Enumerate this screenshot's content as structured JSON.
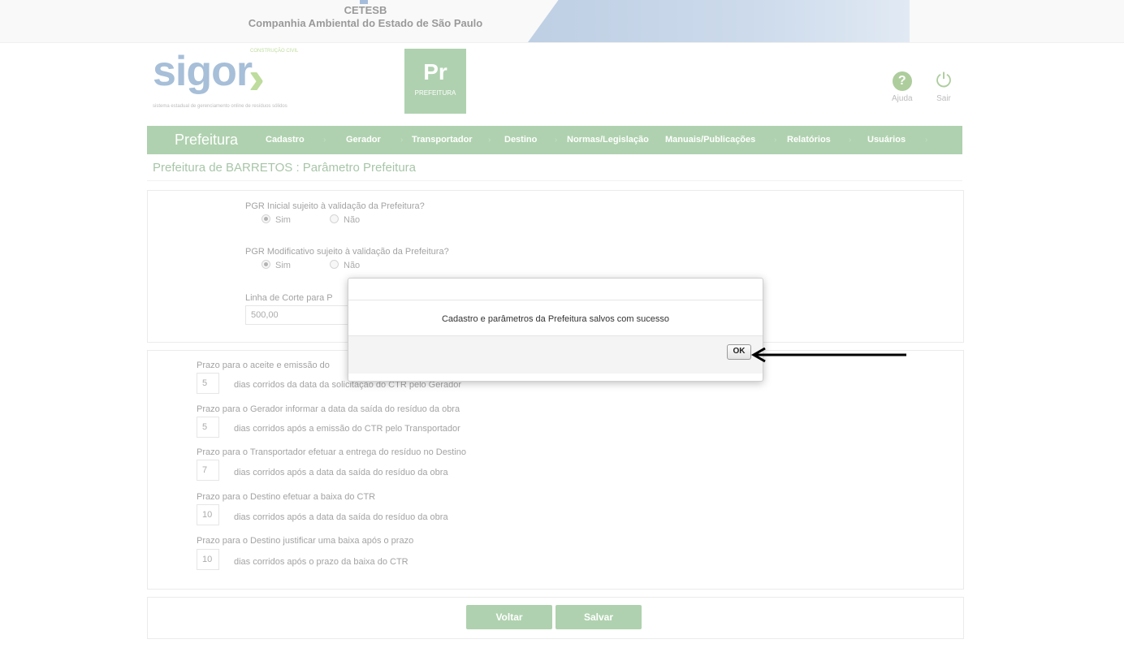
{
  "org": {
    "name": "CETESB",
    "full_name": "Companhia Ambiental do Estado de São Paulo"
  },
  "logo": {
    "word": "sigor",
    "chevrons": "›››",
    "tagline": "CONSTRUÇÃO CIVIL",
    "subtitle": "sistema estadual de gerenciamento online de resíduos sólidos"
  },
  "badge": {
    "code": "Pr",
    "label": "PREFEITURA"
  },
  "header_controls": {
    "help": "Ajuda",
    "exit": "Sair",
    "help_glyph": "?",
    "exit_glyph": "⏻"
  },
  "nav": {
    "brand": "Prefeitura",
    "items": [
      "Cadastro",
      "Gerador",
      "Transportador",
      "Destino",
      "Normas/Legislação",
      "Manuais/Publicações",
      "Relatórios",
      "Usuários"
    ]
  },
  "page_title": "Prefeitura de BARRETOS : Parâmetro Prefeitura",
  "form": {
    "q1": {
      "label": "PGR Inicial sujeito à validação da Prefeitura?",
      "opt_yes": "Sim",
      "opt_no": "Não",
      "selected": "Sim"
    },
    "q2": {
      "label": "PGR Modificativo sujeito à validação da Prefeitura?",
      "opt_yes": "Sim",
      "opt_no": "Não",
      "selected": "Sim"
    },
    "cutline": {
      "label": "Linha de Corte para P",
      "value": "500,00"
    }
  },
  "deadlines": [
    {
      "label": "Prazo para o aceite e emissão do",
      "value": "5",
      "suffix": "dias corridos da data da solicitação do CTR pelo Gerador"
    },
    {
      "label": "Prazo para o Gerador informar a data da saída do resíduo da obra",
      "value": "5",
      "suffix": "dias corridos após a emissão do CTR pelo Transportador"
    },
    {
      "label": "Prazo para o Transportador efetuar a entrega do resíduo no Destino",
      "value": "7",
      "suffix": "dias corridos após a data da saída do resíduo da obra"
    },
    {
      "label": "Prazo para o Destino efetuar a baixa do CTR",
      "value": "10",
      "suffix": "dias corridos após a data da saída do resíduo da obra"
    },
    {
      "label": "Prazo para o Destino justificar uma baixa após o prazo",
      "value": "10",
      "suffix": "dias corridos após o prazo da baixa do CTR"
    }
  ],
  "buttons": {
    "back": "Voltar",
    "save": "Salvar"
  },
  "dialog": {
    "message": "Cadastro e parâmetros da Prefeitura salvos com sucesso",
    "ok": "OK"
  },
  "colors": {
    "green": "#5fa35f",
    "blue": "#4f7fb0",
    "lime": "#7db83a"
  }
}
